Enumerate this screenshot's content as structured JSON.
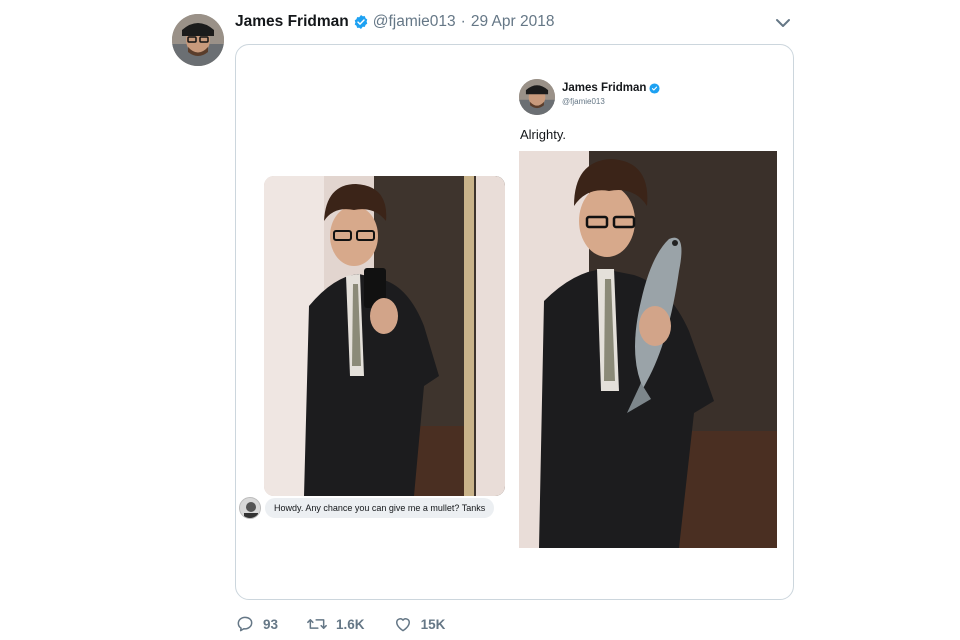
{
  "tweet": {
    "author_name": "James Fridman",
    "handle": "@fjamie013",
    "separator": "·",
    "date": "29 Apr 2018",
    "verified": true
  },
  "media": {
    "dm_message": "Howdy. Any chance you can give me a mullet? Tanks",
    "inner_tweet": {
      "author_name": "James Fridman",
      "handle": "@fjamie013",
      "text": "Alrighty."
    }
  },
  "actions": {
    "reply_count": "93",
    "retweet_count": "1.6K",
    "like_count": "15K"
  },
  "colors": {
    "verified_blue": "#1da1f2",
    "muted_text": "#657786",
    "border": "#ccd6dd"
  },
  "icons": [
    "chevron-down-icon",
    "verified-badge-icon",
    "reply-icon",
    "retweet-icon",
    "like-icon"
  ]
}
